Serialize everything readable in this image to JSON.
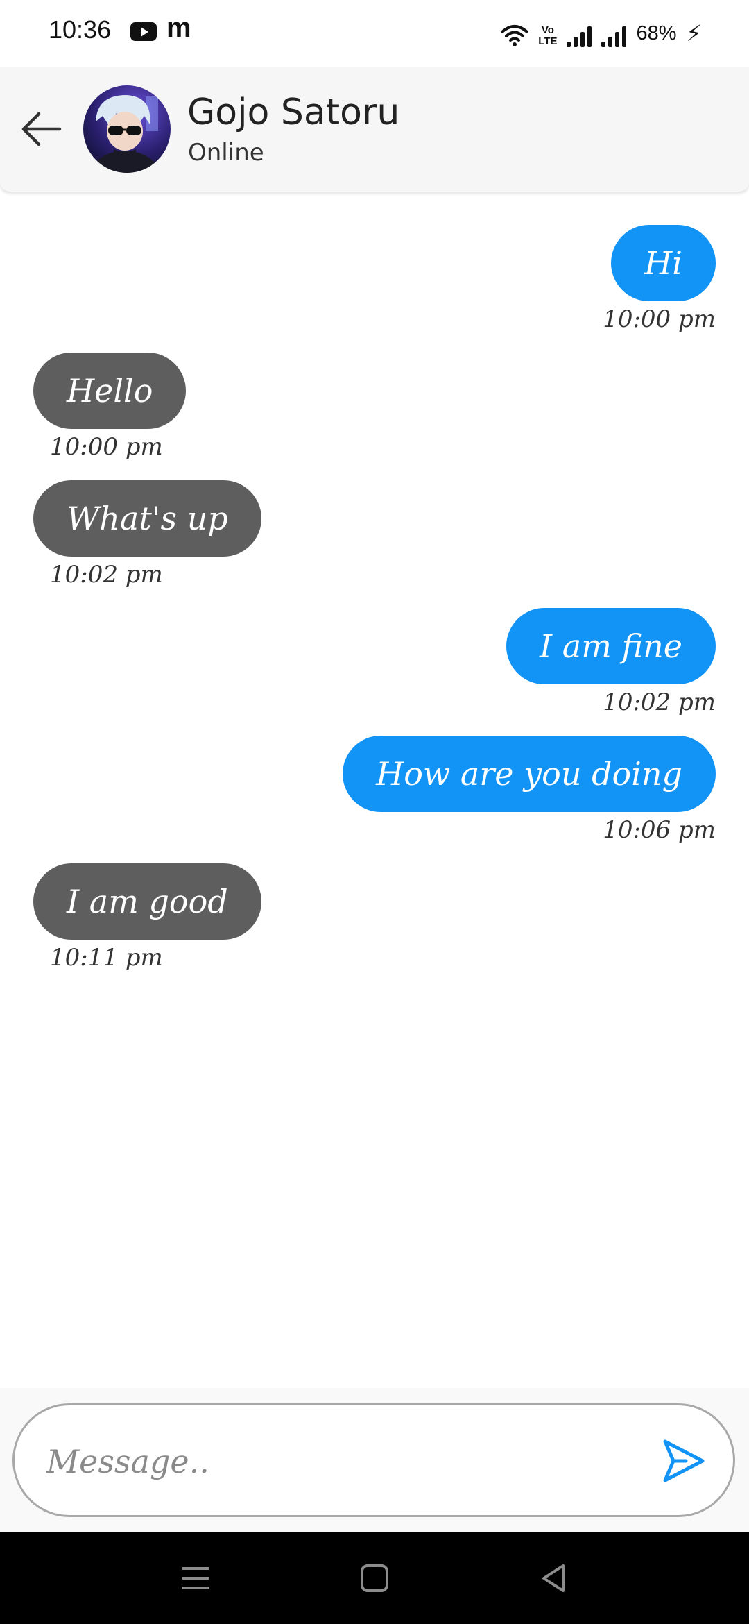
{
  "status_bar": {
    "time": "10:36",
    "youtube_icon": "youtube-icon",
    "app_letter": "m",
    "volte_top": "Vo",
    "volte_bottom": "LTE",
    "battery": "68%"
  },
  "header": {
    "back_icon": "arrow-left-icon",
    "avatar_icon": "avatar",
    "name": "Gojo Satoru",
    "status": "Online"
  },
  "messages": [
    {
      "side": "sent",
      "text": "Hi",
      "time": "10:00 pm"
    },
    {
      "side": "received",
      "text": "Hello",
      "time": "10:00 pm"
    },
    {
      "side": "received",
      "text": "What's up",
      "time": "10:02 pm"
    },
    {
      "side": "sent",
      "text": "I am fine",
      "time": "10:02 pm"
    },
    {
      "side": "sent",
      "text": "How are you doing",
      "time": "10:06 pm"
    },
    {
      "side": "received",
      "text": "I am good",
      "time": "10:11 pm"
    }
  ],
  "composer": {
    "placeholder": "Message..",
    "value": "",
    "send_icon": "send-icon"
  },
  "nav": {
    "icons": [
      "menu-icon",
      "home-icon",
      "back-triangle-icon"
    ]
  },
  "colors": {
    "sent_bubble": "#1293f6",
    "received_bubble": "#5e5e5e",
    "accent": "#1293f6"
  }
}
